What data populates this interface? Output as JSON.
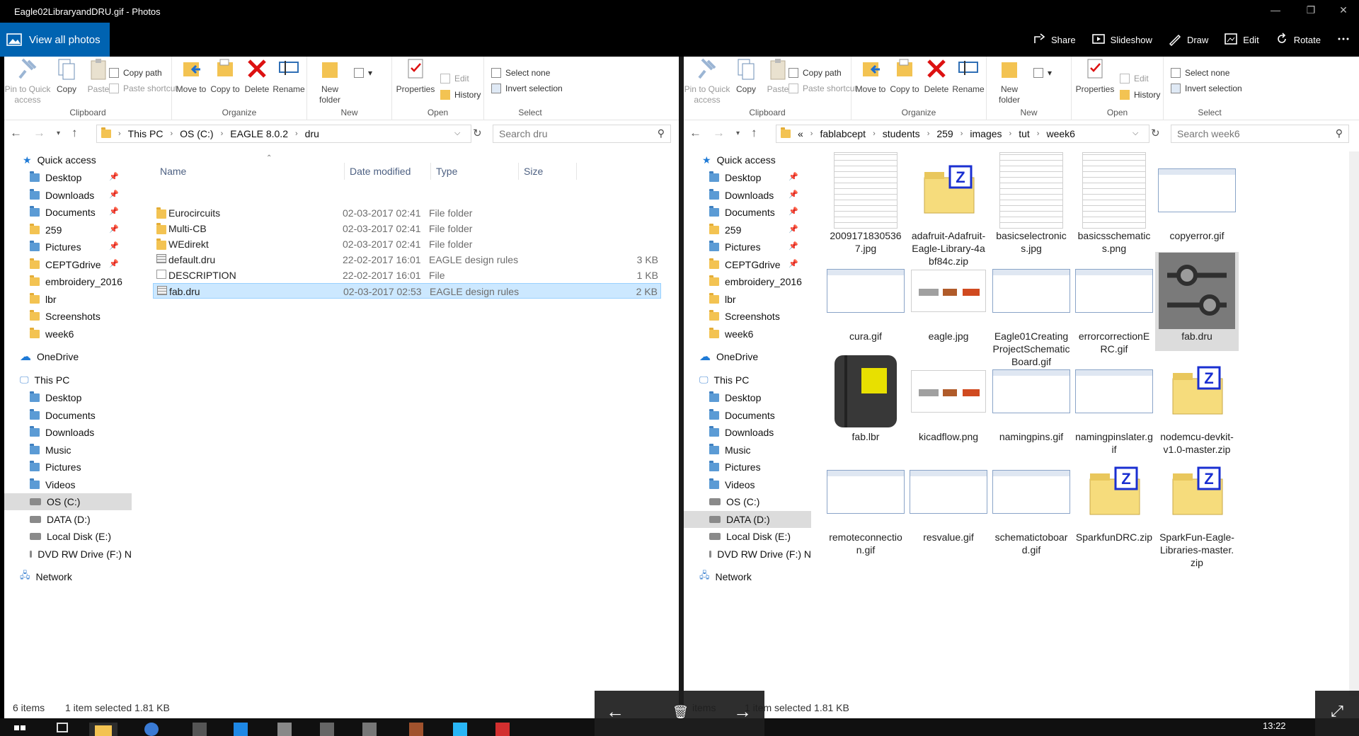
{
  "photos": {
    "window_title": "Eagle02LibraryandDRU.gif - Photos",
    "view_all": "View all photos",
    "actions": [
      {
        "label": "Share",
        "icon": "share-icon"
      },
      {
        "label": "Slideshow",
        "icon": "slideshow-icon"
      },
      {
        "label": "Draw",
        "icon": "draw-icon"
      },
      {
        "label": "Edit",
        "icon": "edit-icon"
      },
      {
        "label": "Rotate",
        "icon": "rotate-icon"
      },
      {
        "label": "...",
        "icon": "more-icon"
      }
    ]
  },
  "ribbon": {
    "pin_quick_access": "Pin to Quick access",
    "copy": "Copy",
    "paste": "Paste",
    "copy_path": "Copy path",
    "paste_shortcut": "Paste shortcut",
    "clipboard": "Clipboard",
    "move_to": "Move to",
    "copy_to": "Copy to",
    "delete": "Delete",
    "rename": "Rename",
    "organize": "Organize",
    "new_folder": "New folder",
    "new": "New",
    "properties": "Properties",
    "edit": "Edit",
    "history": "History",
    "open": "Open",
    "select_none": "Select none",
    "invert_selection": "Invert selection",
    "select": "Select"
  },
  "nav": {
    "quick_access": "Quick access",
    "quick_items": [
      "Desktop",
      "Downloads",
      "Documents",
      "259",
      "Pictures",
      "CEPTGdrive",
      "embroidery_2016",
      "lbr",
      "Screenshots",
      "week6"
    ],
    "onedrive": "OneDrive",
    "this_pc": "This PC",
    "pc_items": [
      "Desktop",
      "Documents",
      "Downloads",
      "Music",
      "Pictures",
      "Videos",
      "OS (C:)",
      "DATA (D:)",
      "Local Disk (E:)",
      "DVD RW Drive (F:) N"
    ],
    "network": "Network"
  },
  "left": {
    "breadcrumb": [
      "This PC",
      "OS (C:)",
      "EAGLE 8.0.2",
      "dru"
    ],
    "search_placeholder": "Search dru",
    "columns": {
      "name": "Name",
      "date": "Date modified",
      "type": "Type",
      "size": "Size"
    },
    "files": [
      {
        "name": "Eurocircuits",
        "date": "02-03-2017 02:41",
        "type": "File folder",
        "size": "",
        "kind": "folder"
      },
      {
        "name": "Multi-CB",
        "date": "02-03-2017 02:41",
        "type": "File folder",
        "size": "",
        "kind": "folder"
      },
      {
        "name": "WEdirekt",
        "date": "02-03-2017 02:41",
        "type": "File folder",
        "size": "",
        "kind": "folder"
      },
      {
        "name": "default.dru",
        "date": "22-02-2017 16:01",
        "type": "EAGLE design rules",
        "size": "3 KB",
        "kind": "dru"
      },
      {
        "name": "DESCRIPTION",
        "date": "22-02-2017 16:01",
        "type": "File",
        "size": "1 KB",
        "kind": "file"
      },
      {
        "name": "fab.dru",
        "date": "02-03-2017 02:53",
        "type": "EAGLE design rules",
        "size": "2 KB",
        "kind": "dru"
      }
    ],
    "status_items": "6 items",
    "status_selected": "1 item selected  1.81 KB"
  },
  "right": {
    "breadcrumb": [
      "«",
      "fablabcept",
      "students",
      "259",
      "images",
      "tut",
      "week6"
    ],
    "search_placeholder": "Search week6",
    "tiles": [
      {
        "name": "20091718305367.jpg",
        "kind": "doc"
      },
      {
        "name": "adafruit-Adafruit-Eagle-Library-4abf84c.zip",
        "kind": "zip"
      },
      {
        "name": "basicselectronics.jpg",
        "kind": "doc"
      },
      {
        "name": "basicsschematics.png",
        "kind": "doc"
      },
      {
        "name": "copyerror.gif",
        "kind": "shot"
      },
      {
        "name": "cura.gif",
        "kind": "shot"
      },
      {
        "name": "eagle.jpg",
        "kind": "flow"
      },
      {
        "name": "Eagle01CreatingProjectSchematicBoard.gif",
        "kind": "shot"
      },
      {
        "name": "errorcorrectionERC.gif",
        "kind": "shot"
      },
      {
        "name": "fab.dru",
        "kind": "dru"
      },
      {
        "name": "fab.lbr",
        "kind": "lbr"
      },
      {
        "name": "kicadflow.png",
        "kind": "flow"
      },
      {
        "name": "namingpins.gif",
        "kind": "shot"
      },
      {
        "name": "namingpinslater.gif",
        "kind": "shot"
      },
      {
        "name": "nodemcu-devkit-v1.0-master.zip",
        "kind": "zip"
      },
      {
        "name": "remoteconnection.gif",
        "kind": "shot"
      },
      {
        "name": "resvalue.gif",
        "kind": "shot"
      },
      {
        "name": "schematictoboard.gif",
        "kind": "shot"
      },
      {
        "name": "SparkfunDRC.zip",
        "kind": "zip"
      },
      {
        "name": "SparkFun-Eagle-Libraries-master.zip",
        "kind": "zip"
      }
    ],
    "status_items": "items",
    "status_selected": "1 item selected  1.81 KB"
  },
  "taskbar": {
    "clock": "13:22"
  }
}
